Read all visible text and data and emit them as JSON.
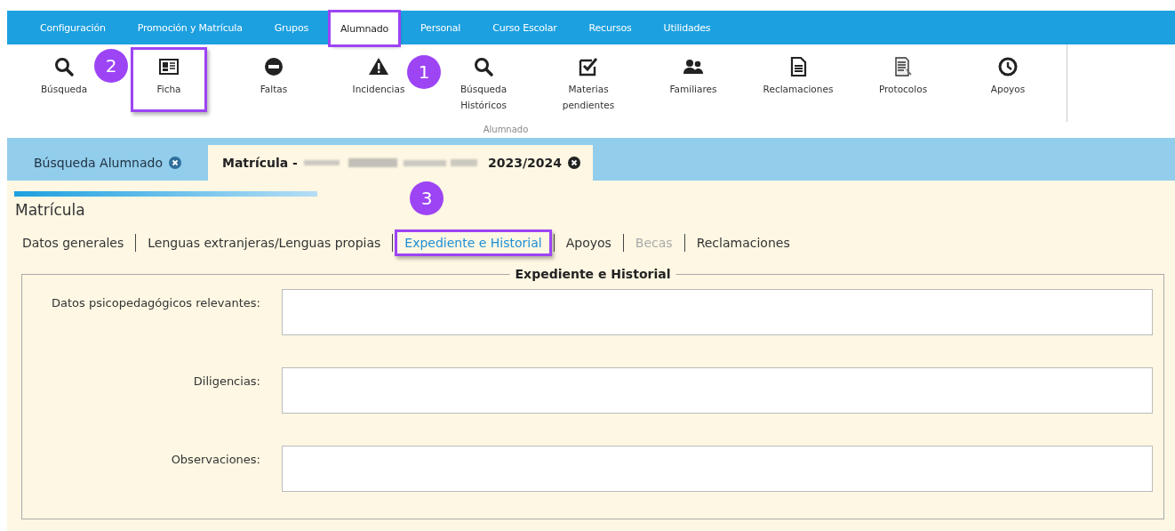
{
  "menu": [
    {
      "label": "Configuración",
      "selected": false,
      "highlighted": false
    },
    {
      "label": "Promoción y Matrícula",
      "selected": false,
      "highlighted": false
    },
    {
      "label": "Grupos",
      "selected": false,
      "highlighted": false
    },
    {
      "label": "Alumnado",
      "selected": true,
      "highlighted": true
    },
    {
      "label": "Personal",
      "selected": false,
      "highlighted": false
    },
    {
      "label": "Curso Escolar",
      "selected": false,
      "highlighted": false
    },
    {
      "label": "Recursos",
      "selected": false,
      "highlighted": false
    },
    {
      "label": "Utilidades",
      "selected": false,
      "highlighted": false
    }
  ],
  "ribbon": {
    "group_label": "Alumnado",
    "items": [
      {
        "lines": [
          "Búsqueda"
        ],
        "highlighted": false
      },
      {
        "lines": [
          "Ficha"
        ],
        "highlighted": true
      },
      {
        "lines": [
          "Faltas"
        ],
        "highlighted": false
      },
      {
        "lines": [
          "Incidencias"
        ],
        "highlighted": false
      },
      {
        "lines": [
          "Búsqueda",
          "Históricos"
        ],
        "highlighted": false
      },
      {
        "lines": [
          "Materias",
          "pendientes"
        ],
        "highlighted": false
      },
      {
        "lines": [
          "Familiares"
        ],
        "highlighted": false
      },
      {
        "lines": [
          "Reclamaciones"
        ],
        "highlighted": false
      },
      {
        "lines": [
          "Protocolos"
        ],
        "highlighted": false
      },
      {
        "lines": [
          "Apoyos"
        ],
        "highlighted": false
      }
    ]
  },
  "doc_tabs": [
    {
      "title": "Búsqueda Alumnado",
      "selected": false
    },
    {
      "title": "Matrícula -",
      "title_suffix": "2023/2024",
      "redacted": true,
      "selected": true
    }
  ],
  "page": {
    "title": "Matrícula",
    "subtabs": [
      {
        "label": "Datos generales",
        "selected": false,
        "disabled": false,
        "highlighted": false
      },
      {
        "label": "Lenguas extranjeras/Lenguas propias",
        "selected": false,
        "disabled": false,
        "highlighted": false
      },
      {
        "label": "Expediente e Historial",
        "selected": true,
        "disabled": false,
        "highlighted": true
      },
      {
        "label": "Apoyos",
        "selected": false,
        "disabled": false,
        "highlighted": false
      },
      {
        "label": "Becas",
        "selected": false,
        "disabled": true,
        "highlighted": false
      },
      {
        "label": "Reclamaciones",
        "selected": false,
        "disabled": false,
        "highlighted": false
      }
    ],
    "section": {
      "legend": "Expediente e Historial",
      "fields": [
        {
          "label": "Datos psicopedagógicos relevantes:"
        },
        {
          "label": "Diligencias:"
        },
        {
          "label": "Observaciones:"
        }
      ]
    }
  },
  "callouts": [
    "1",
    "2",
    "3"
  ]
}
